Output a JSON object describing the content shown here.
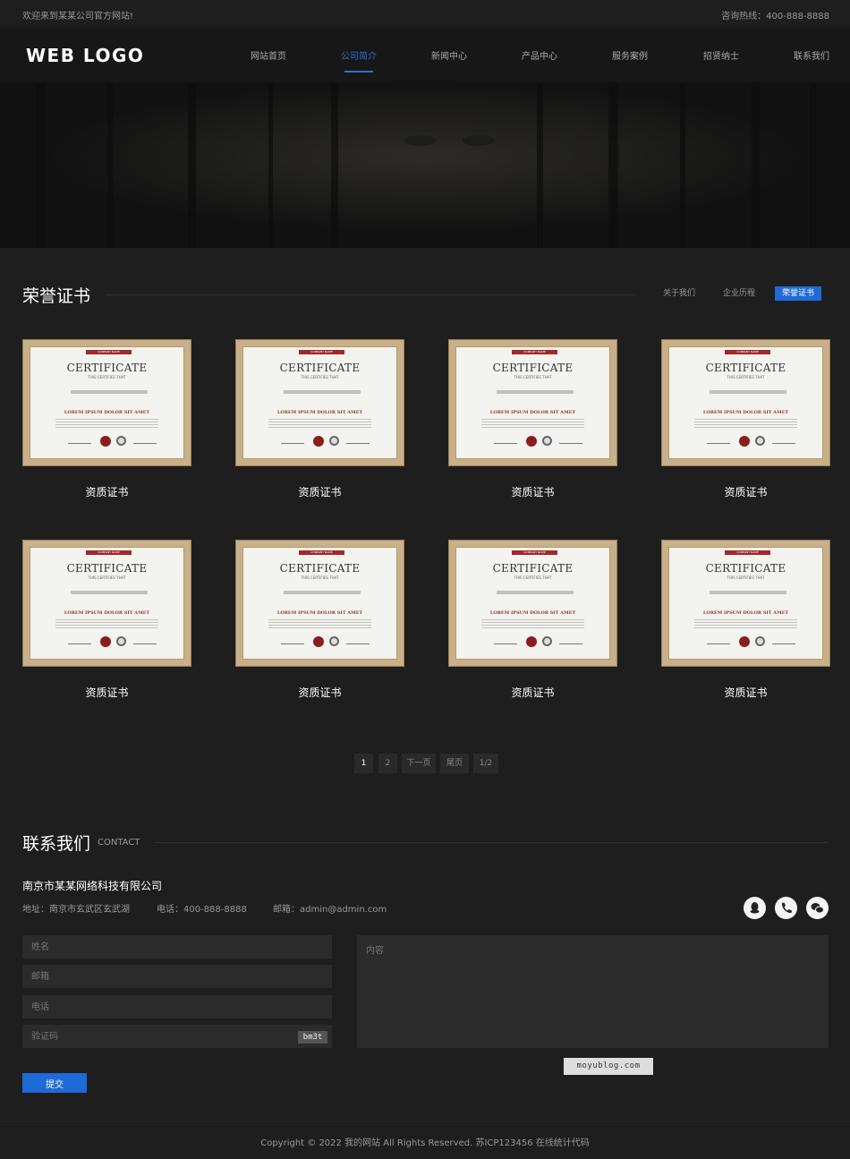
{
  "topbar": {
    "welcome": "欢迎来到某某公司官方网站!",
    "hotline": "咨询热线：400-888-8888"
  },
  "header": {
    "logo": "WEB LOGO"
  },
  "nav": [
    {
      "label": "网站首页"
    },
    {
      "label": "公司简介",
      "active": true
    },
    {
      "label": "新闻中心"
    },
    {
      "label": "产品中心"
    },
    {
      "label": "服务案例"
    },
    {
      "label": "招贤纳士"
    },
    {
      "label": "联系我们"
    }
  ],
  "section": {
    "title": "荣誉证书",
    "subnav": [
      {
        "label": "关于我们"
      },
      {
        "label": "企业历程"
      },
      {
        "label": "荣誉证书",
        "active": true
      }
    ]
  },
  "certificate": {
    "ribbon": "COMPANY NAME",
    "title": "CERTIFICATE",
    "subtitle": "THIS CERTIFIES THAT",
    "lorem": "LOREM IPSUM DOLOR SIT AMET"
  },
  "cards": [
    {
      "caption": "资质证书"
    },
    {
      "caption": "资质证书"
    },
    {
      "caption": "资质证书"
    },
    {
      "caption": "资质证书"
    },
    {
      "caption": "资质证书"
    },
    {
      "caption": "资质证书"
    },
    {
      "caption": "资质证书"
    },
    {
      "caption": "资质证书"
    }
  ],
  "pager": {
    "pages": [
      "1",
      "2"
    ],
    "next": "下一页",
    "last": "尾页",
    "count": "1/2"
  },
  "contact": {
    "title": "联系我们",
    "title_en": "CONTACT",
    "company": "南京市某某网络科技有限公司",
    "address": "地址：南京市玄武区玄武湖",
    "phone": "电话：400-888-8888",
    "email": "邮箱：admin@admin.com",
    "social": [
      {
        "icon": "qq-icon"
      },
      {
        "icon": "phone-icon"
      },
      {
        "icon": "wechat-icon"
      }
    ]
  },
  "form": {
    "name_placeholder": "姓名",
    "email_placeholder": "邮箱",
    "phone_placeholder": "电话",
    "captcha_placeholder": "验证码",
    "content_placeholder": "内容",
    "captcha_code": "bm3t",
    "submit": "提交"
  },
  "watermark": "moyublog.com",
  "footer": {
    "copyright": "Copyright © 2022 我的网站 All Rights Reserved. 苏ICP123456 在线统计代码"
  }
}
